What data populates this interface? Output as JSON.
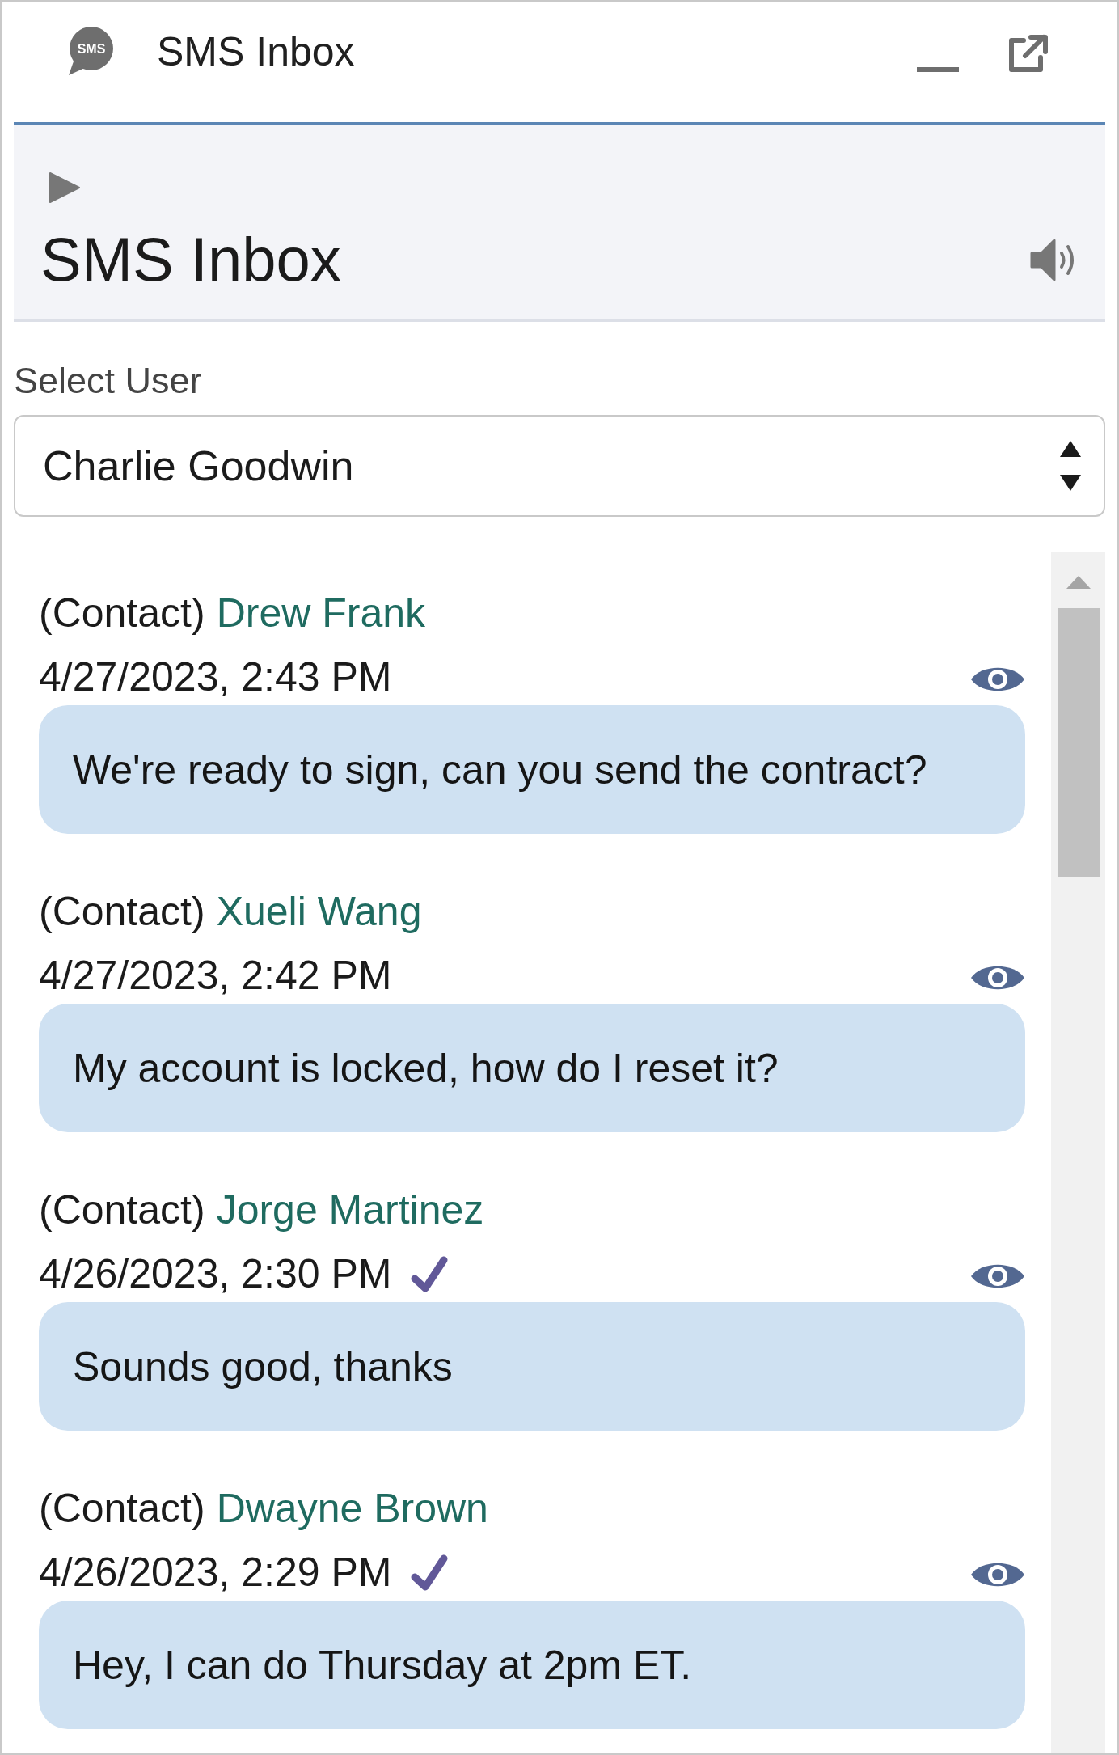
{
  "title_bar": {
    "logo_text": "SMS",
    "title": "SMS Inbox"
  },
  "header": {
    "title": "SMS Inbox"
  },
  "user_select": {
    "label": "Select User",
    "value": "Charlie Goodwin"
  },
  "messages": [
    {
      "sender_type": "(Contact)",
      "sender_name": "Drew Frank",
      "timestamp": "4/27/2023, 2:43 PM",
      "checked": false,
      "text": "We're ready to sign, can you send the contract?"
    },
    {
      "sender_type": "(Contact)",
      "sender_name": "Xueli Wang",
      "timestamp": "4/27/2023, 2:42 PM",
      "checked": false,
      "text": "My account is locked, how do I reset it?"
    },
    {
      "sender_type": "(Contact)",
      "sender_name": "Jorge Martinez",
      "timestamp": "4/26/2023, 2:30 PM",
      "checked": true,
      "text": "Sounds good, thanks"
    },
    {
      "sender_type": "(Contact)",
      "sender_name": "Dwayne Brown",
      "timestamp": "4/26/2023, 2:29 PM",
      "checked": true,
      "text": "Hey, I can do Thursday at 2pm ET."
    }
  ]
}
